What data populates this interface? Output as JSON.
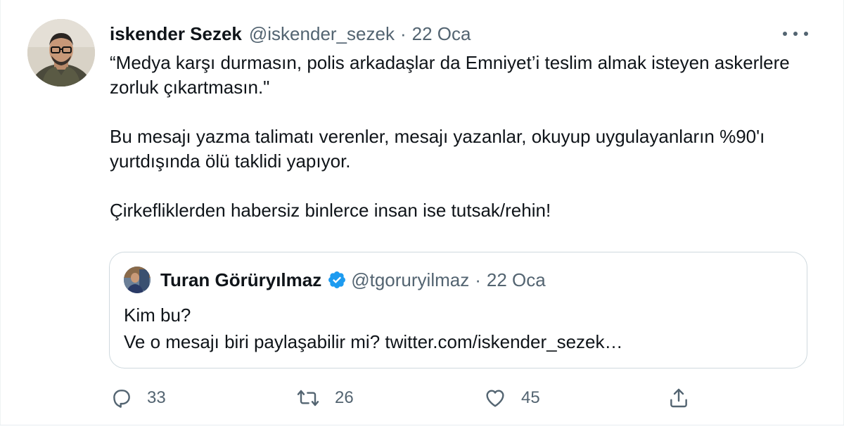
{
  "tweet": {
    "author_name": "iskender Sezek",
    "handle": "@iskender_sezek",
    "separator": "·",
    "date": "22 Oca",
    "text": "“Medya karşı durmasın, polis arkadaşlar da Emniyet’i teslim almak isteyen askerlere zorluk çıkartmasın.\"\n\nBu mesajı yazma talimatı verenler, mesajı yazanlar, okuyup uygulayanların %90'ı yurtdışında ölü taklidi yapıyor.\n\nÇirkefliklerden habersiz binlerce insan ise tutsak/rehin!",
    "more_icon": "more-horizontal-icon"
  },
  "quoted_tweet": {
    "author_name": "Turan Görüryılmaz",
    "verified_icon": "verified-badge-icon",
    "handle": "@tgoruryilmaz",
    "separator": "·",
    "date": "22 Oca",
    "text": "Kim bu?\nVe o mesajı biri paylaşabilir mi? twitter.com/iskender_sezek…"
  },
  "actions": {
    "reply": {
      "icon": "reply-icon",
      "count": "33"
    },
    "retweet": {
      "icon": "retweet-icon",
      "count": "26"
    },
    "like": {
      "icon": "heart-icon",
      "count": "45"
    },
    "share": {
      "icon": "share-icon"
    }
  },
  "colors": {
    "text_primary": "#0f1419",
    "text_secondary": "#536471",
    "border": "#cfd9de",
    "verified_blue": "#1d9bf0"
  }
}
